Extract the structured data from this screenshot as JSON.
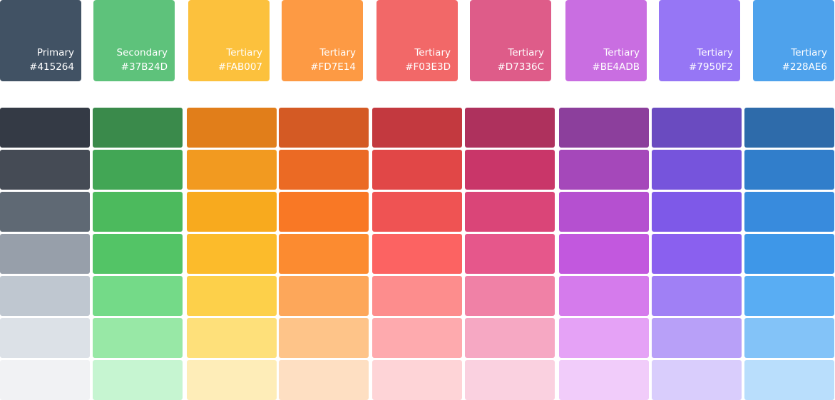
{
  "swatches": [
    {
      "label": "Primary",
      "hex": "#415264",
      "color": "#415264"
    },
    {
      "label": "Secondary",
      "hex": "#37B24D",
      "color": "#5EC27B"
    },
    {
      "label": "Tertiary",
      "hex": "#FAB007",
      "color": "#FCC13D"
    },
    {
      "label": "Tertiary",
      "hex": "#FD7E14",
      "color": "#FD9A44"
    },
    {
      "label": "Tertiary",
      "hex": "#F03E3D",
      "color": "#F26868"
    },
    {
      "label": "Tertiary",
      "hex": "#D7336C",
      "color": "#DE5C89"
    },
    {
      "label": "Tertiary",
      "hex": "#BE4ADB",
      "color": "#C96EE1"
    },
    {
      "label": "Tertiary",
      "hex": "#7950F2",
      "color": "#9676F5"
    },
    {
      "label": "Tertiary",
      "hex": "#228AE6",
      "color": "#4EA2EC"
    }
  ],
  "shades": [
    [
      "#343A45",
      "#454B55",
      "#5F6974",
      "#979FAA",
      "#BFC7D0",
      "#DCE1E7",
      "#F1F2F4"
    ],
    [
      "#3A8A4B",
      "#42A655",
      "#4CBA5D",
      "#53C466",
      "#74DA88",
      "#98E8A6",
      "#C6F5D1"
    ],
    [
      "#E17E1A",
      "#F29A20",
      "#F8AA1E",
      "#FCBB2B",
      "#FDD04A",
      "#FEE07A",
      "#FEEDB8"
    ],
    [
      "#D45A24",
      "#EB6A24",
      "#F97825",
      "#FC8B30",
      "#FDA75A",
      "#FEC489",
      "#FEDFC2"
    ],
    [
      "#C3393F",
      "#E14747",
      "#EF5353",
      "#FC6362",
      "#FD8D8D",
      "#FEAAAE",
      "#FED4D7"
    ],
    [
      "#AE315D",
      "#C93669",
      "#DA4578",
      "#E6578B",
      "#F081A6",
      "#F6A8C3",
      "#FAD1E0"
    ],
    [
      "#8C3F9C",
      "#A548BA",
      "#B550D0",
      "#C258DE",
      "#D57BEC",
      "#E5A2F6",
      "#F1CCFA"
    ],
    [
      "#6A4BC0",
      "#7654DC",
      "#7E59E8",
      "#8A60EF",
      "#A080F5",
      "#B8A0F8",
      "#D9CDFC"
    ],
    [
      "#2E6BAA",
      "#317ECB",
      "#388BDD",
      "#3E97E8",
      "#59ADF3",
      "#83C3F8",
      "#B9DEFC"
    ]
  ]
}
